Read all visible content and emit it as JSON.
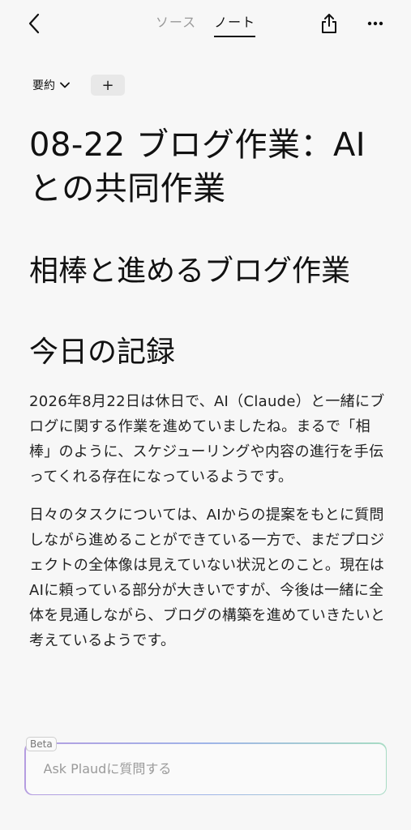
{
  "nav": {
    "tabs": [
      {
        "label": "ソース",
        "active": false
      },
      {
        "label": "ノート",
        "active": true
      }
    ]
  },
  "toolbar": {
    "summary_label": "要約",
    "add_label": "+"
  },
  "note": {
    "title": "08-22 ブログ作業：AIとの共同作業",
    "heading1": "相棒と進めるブログ作業",
    "heading2": "今日の記録",
    "paragraphs": [
      "2026年8月22日は休日で、AI（Claude）と一緒にブログに関する作業を進めていましたね。まるで「相棒」のように、スケジューリングや内容の進行を手伝ってくれる存在になっているようです。",
      "日々のタスクについては、AIからの提案をもとに質問しながら進めることができている一方で、まだプロジェクトの全体像は見えていない状況とのこと。現在はAIに頼っている部分が大きいですが、今後は一緒に全体を見通しながら、ブログの構築を進めていきたいと考えているようです。"
    ]
  },
  "ask": {
    "badge": "Beta",
    "placeholder": "Ask Plaudに質問する"
  },
  "colors": {
    "background": "#f7f7f7",
    "text": "#111111",
    "muted": "#9a9a9a",
    "gradient": [
      "#b59de0",
      "#9fb4e8",
      "#a8dcc4"
    ]
  },
  "icons": [
    "back-chevron-icon",
    "share-icon",
    "more-icon",
    "chevron-down-icon"
  ]
}
